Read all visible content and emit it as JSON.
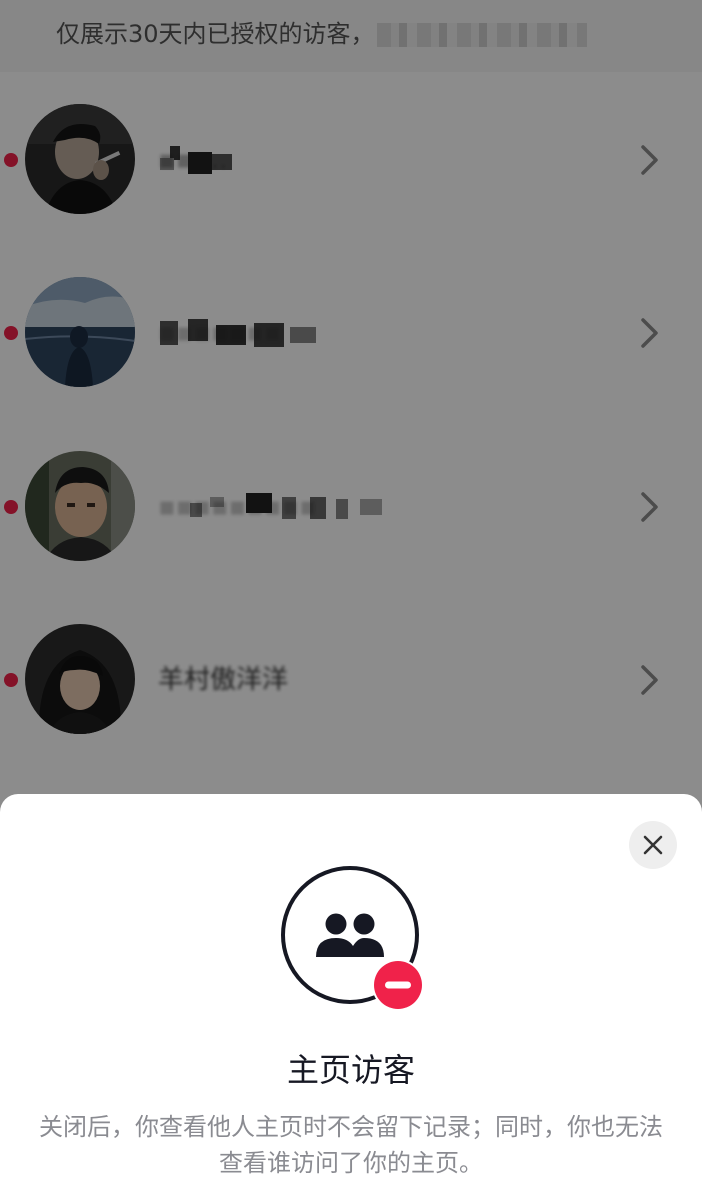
{
  "notice": {
    "text": "仅展示30天内已授权的访客，",
    "trailing_hidden": "i"
  },
  "visitors": [
    {
      "name": "▪▪▪..",
      "avatar": "avatar-man-smoking",
      "unread": true
    },
    {
      "name": "▪▪▪▪▪▪▪",
      "avatar": "avatar-person-sea",
      "unread": true
    },
    {
      "name": "▪▪▪▪▪▪▪▪▪",
      "avatar": "avatar-man-face",
      "unread": true
    },
    {
      "name": "羊村傲洋洋",
      "avatar": "avatar-boy-hoodie",
      "unread": true
    }
  ],
  "sheet": {
    "title": "主页访客",
    "description": "关闭后，你查看他人主页时不会留下记录；同时，你也无法查看谁访问了你的主页。"
  },
  "colors": {
    "accent_red": "#f0224a",
    "overlay": "rgba(0,0,0,0.45)",
    "title": "#161823",
    "description": "#8a8b91"
  },
  "icons": {
    "close": "close-icon",
    "feature": "visitors-off-icon",
    "chevron": "chevron-right-icon"
  }
}
